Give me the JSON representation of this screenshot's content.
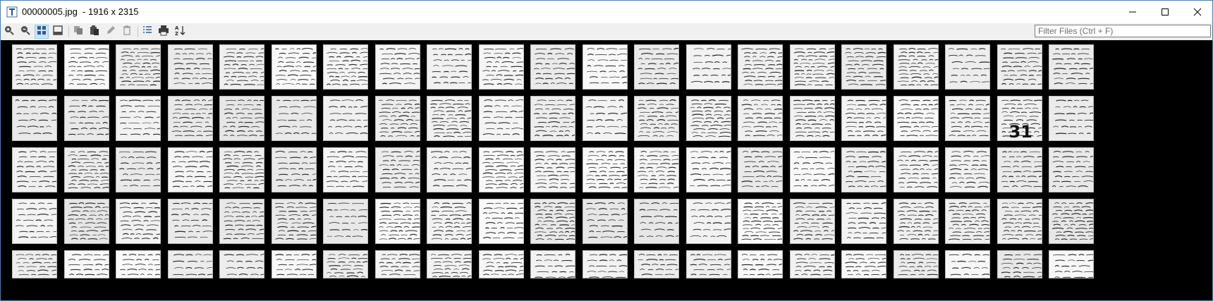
{
  "window": {
    "title": "00000005.jpg  - 1916 x 2315",
    "app_icon": "text-viewer-icon"
  },
  "caption": {
    "minimize_icon": "minimize-icon",
    "maximize_icon": "maximize-icon",
    "close_icon": "close-icon"
  },
  "toolbar": {
    "buttons": [
      {
        "name": "zoom-in-icon",
        "active": false
      },
      {
        "name": "zoom-out-icon",
        "active": false
      },
      {
        "name": "grid-view-icon",
        "active": true
      },
      {
        "name": "single-view-icon",
        "active": false
      },
      {
        "name": "copy-icon",
        "active": false
      },
      {
        "name": "paste-icon",
        "active": false
      },
      {
        "name": "rename-icon",
        "active": false
      },
      {
        "name": "delete-icon",
        "active": false
      },
      {
        "name": "list-icon",
        "active": false
      },
      {
        "name": "print-icon",
        "active": false
      },
      {
        "name": "sort-az-icon",
        "active": false
      }
    ]
  },
  "filter": {
    "value": "",
    "placeholder": "Filter Files (Ctrl + F)"
  },
  "grid": {
    "rows": 5,
    "columns": 21,
    "special_thumbnails": [
      {
        "row": 1,
        "col": 19,
        "label": "31"
      }
    ],
    "colors": {
      "background": "#000000",
      "page": "#f4f4f4",
      "ink": "#222222"
    }
  }
}
